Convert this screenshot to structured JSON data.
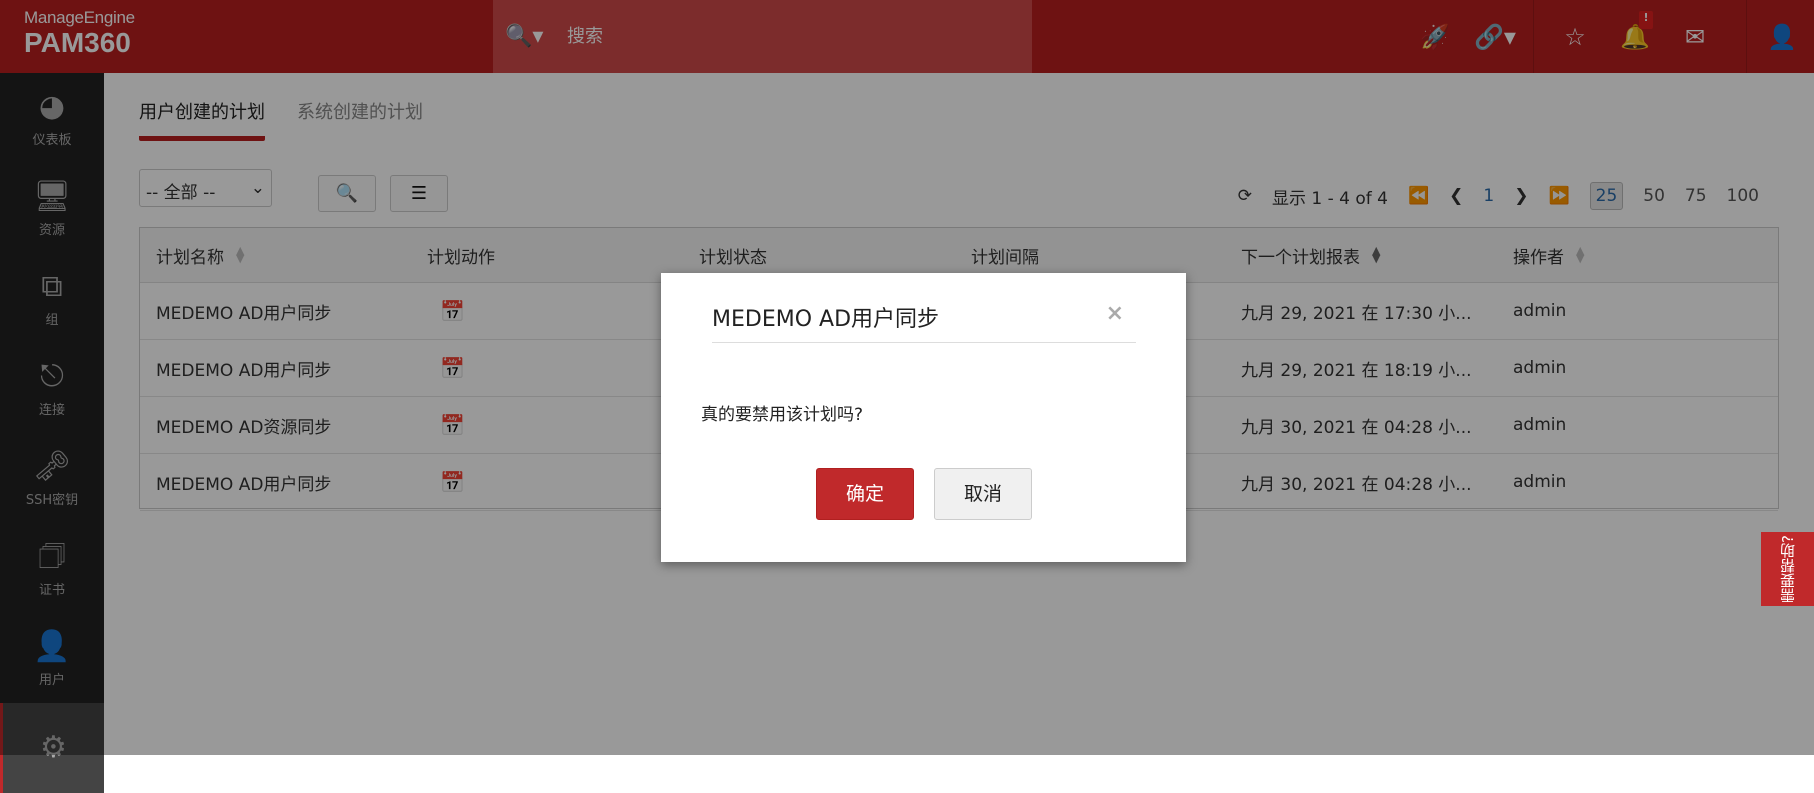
{
  "header": {
    "brand": "ManageEngine",
    "product": "PAM360",
    "search_placeholder": "搜索",
    "notif_badge": "!"
  },
  "sidebar": {
    "items": [
      {
        "label": "仪表板",
        "icon": "dashboard-icon"
      },
      {
        "label": "资源",
        "icon": "monitor-icon"
      },
      {
        "label": "组",
        "icon": "groups-icon"
      },
      {
        "label": "连接",
        "icon": "connection-icon"
      },
      {
        "label": "SSH密钥",
        "icon": "ssh-key-icon"
      },
      {
        "label": "证书",
        "icon": "certificate-icon"
      },
      {
        "label": "用户",
        "icon": "user-icon"
      },
      {
        "label": "",
        "icon": "gear-icon"
      }
    ]
  },
  "tabs": [
    "用户创建的计划",
    "系统创建的计划"
  ],
  "toolbar": {
    "filter_value": "-- 全部 --"
  },
  "pager": {
    "range": "显示 1 - 4 of 4",
    "page": "1",
    "sizes": [
      "25",
      "50",
      "75",
      "100"
    ]
  },
  "table": {
    "columns": [
      "计划名称",
      "计划动作",
      "计划状态",
      "计划间隔",
      "下一个计划报表",
      "操作者"
    ],
    "rows": [
      {
        "name": "MEDEMO AD用户同步",
        "next": "九月 29, 2021 在 17:30 小...",
        "operator": "admin"
      },
      {
        "name": "MEDEMO AD用户同步",
        "next": "九月 29, 2021 在 18:19 小...",
        "operator": "admin"
      },
      {
        "name": "MEDEMO AD资源同步",
        "next": "九月 30, 2021 在 04:28 小...",
        "operator": "admin"
      },
      {
        "name": "MEDEMO AD用户同步",
        "next": "九月 30, 2021 在 04:28 小...",
        "operator": "admin"
      }
    ]
  },
  "help_tab": "需要帮助?",
  "dialog": {
    "title": "MEDEMO AD用户同步",
    "close": "×",
    "message": "真的要禁用该计划吗?",
    "ok": "确定",
    "cancel": "取消"
  }
}
